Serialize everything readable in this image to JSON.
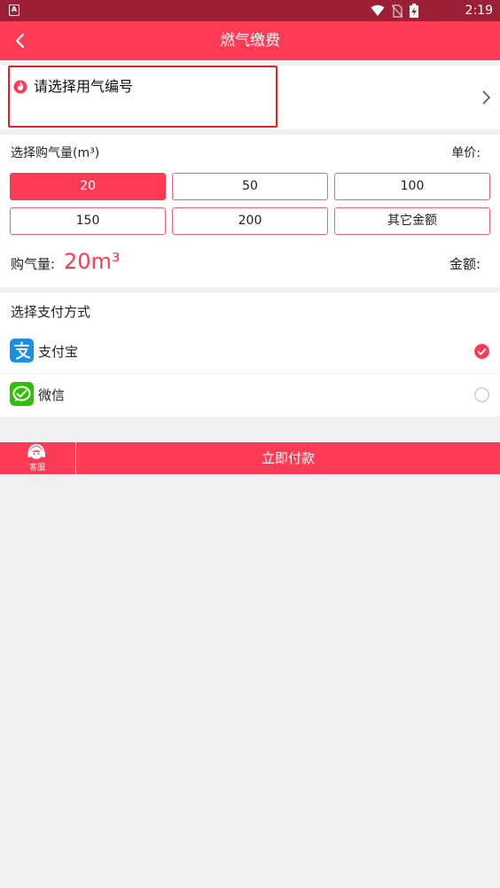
{
  "status_bar": {
    "time": "2:19"
  },
  "nav": {
    "title": "燃气缴费"
  },
  "account": {
    "label": "请选择用气编号"
  },
  "gas": {
    "heading": "选择购气量(m³)",
    "unit_price_label": "单价:",
    "options": [
      "20",
      "50",
      "100",
      "150",
      "200",
      "其它金额"
    ],
    "selected": "20",
    "qty_label": "购气量:",
    "qty_value": "20m³",
    "amount_label": "金额:"
  },
  "payment": {
    "heading": "选择支付方式",
    "methods": [
      {
        "name": "支付宝",
        "icon": "alipay-icon",
        "selected": true
      },
      {
        "name": "微信",
        "icon": "wechat-icon",
        "selected": false
      }
    ]
  },
  "bottom": {
    "service_label": "客服",
    "pay_label": "立即付款"
  },
  "colors": {
    "accent": "#fe3b55",
    "status_bar": "#9b2035",
    "alipay": "#1a8fe3",
    "wechat": "#2dc100"
  }
}
